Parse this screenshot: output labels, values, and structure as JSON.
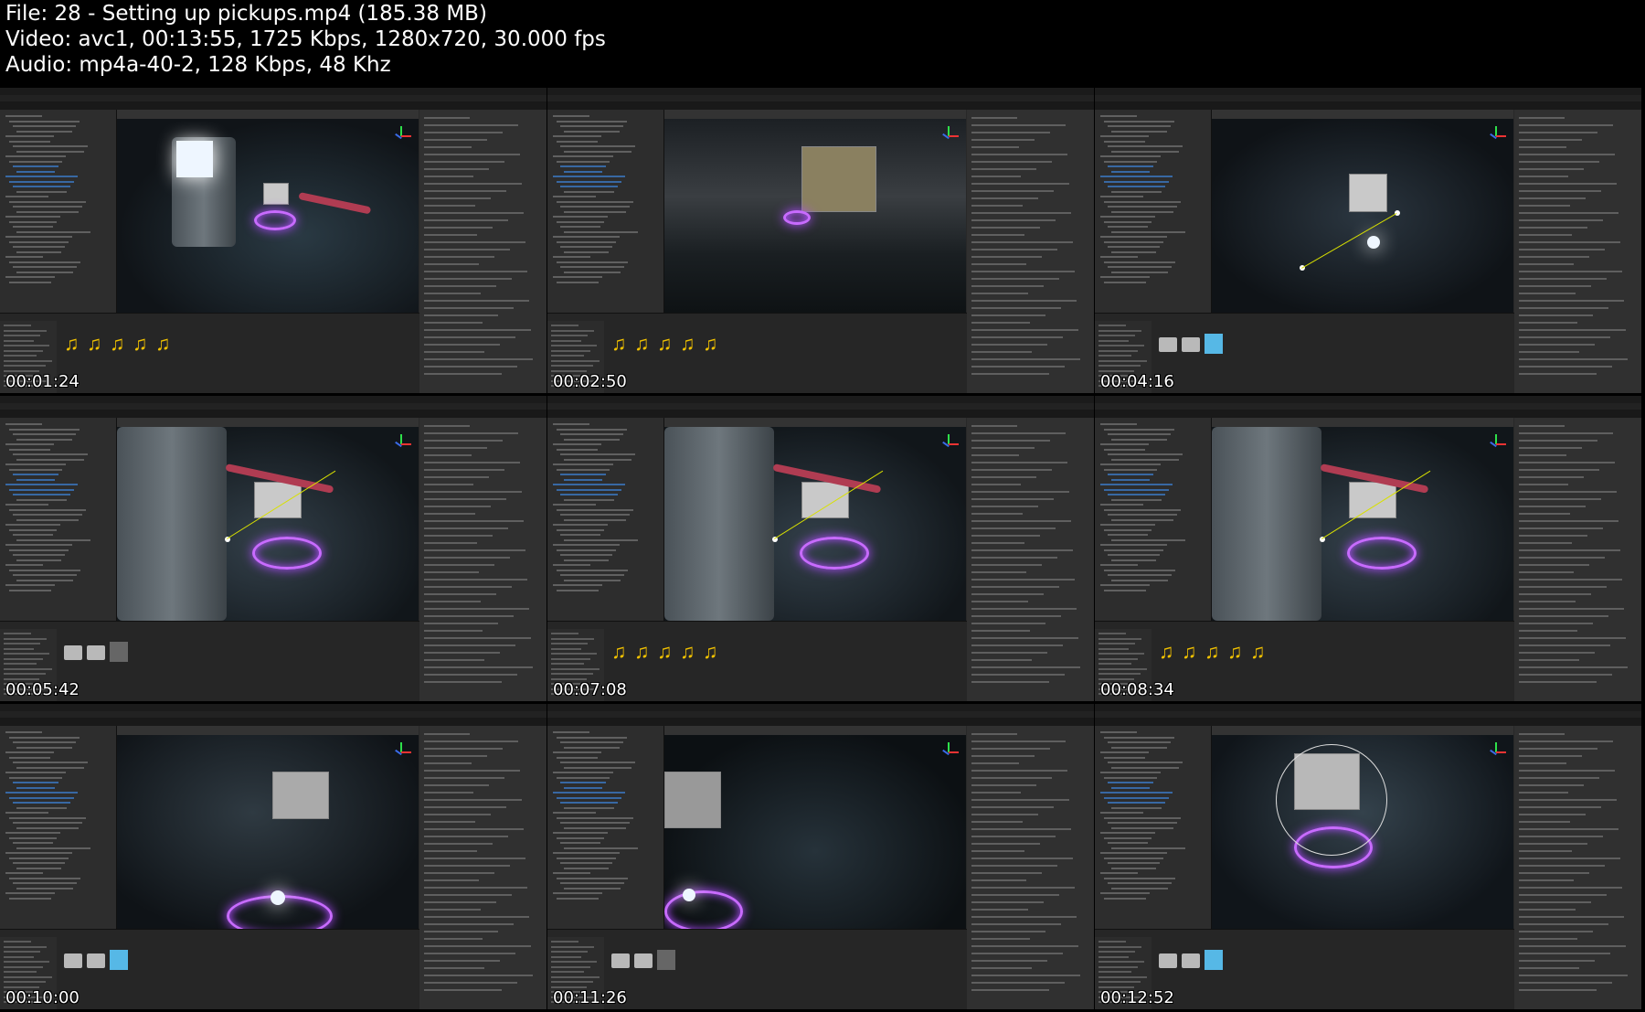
{
  "header": {
    "file_line": "File: 28 - Setting up pickups.mp4 (185.38 MB)",
    "video_line": "Video: avc1, 00:13:55, 1725 Kbps, 1280x720, 30.000 fps",
    "audio_line": "Audio: mp4a-40-2, 128 Kbps, 48 Khz"
  },
  "thumbnails": [
    {
      "timestamp": "00:01:24",
      "scene": "lamp-portal",
      "assets": [
        "audio",
        "audio",
        "audio",
        "audio",
        "audio"
      ]
    },
    {
      "timestamp": "00:02:50",
      "scene": "door-wall",
      "assets": [
        "audio",
        "audio",
        "audio",
        "audio",
        "audio"
      ]
    },
    {
      "timestamp": "00:04:16",
      "scene": "crate-light",
      "assets": [
        "folder",
        "folder",
        "cube"
      ]
    },
    {
      "timestamp": "00:05:42",
      "scene": "crate-portal",
      "assets": [
        "folder",
        "folder",
        "gun"
      ]
    },
    {
      "timestamp": "00:07:08",
      "scene": "crate-portal-2",
      "assets": [
        "audio",
        "audio",
        "audio",
        "audio",
        "audio"
      ]
    },
    {
      "timestamp": "00:08:34",
      "scene": "crate-portal-3",
      "assets": [
        "audio",
        "audio",
        "audio",
        "audio",
        "audio"
      ]
    },
    {
      "timestamp": "00:10:00",
      "scene": "gun-portal",
      "assets": [
        "folder",
        "folder",
        "cube"
      ]
    },
    {
      "timestamp": "00:11:26",
      "scene": "gun-floor",
      "assets": [
        "folder",
        "folder",
        "gun"
      ]
    },
    {
      "timestamp": "00:12:52",
      "scene": "gun-spin",
      "assets": [
        "folder",
        "folder",
        "cube"
      ]
    }
  ],
  "colors": {
    "background": "#000000",
    "editor_panel": "#2d2d2d",
    "portal": "#c86bff",
    "audio_icon": "#f2c200",
    "selection": "#3a6fb0"
  }
}
